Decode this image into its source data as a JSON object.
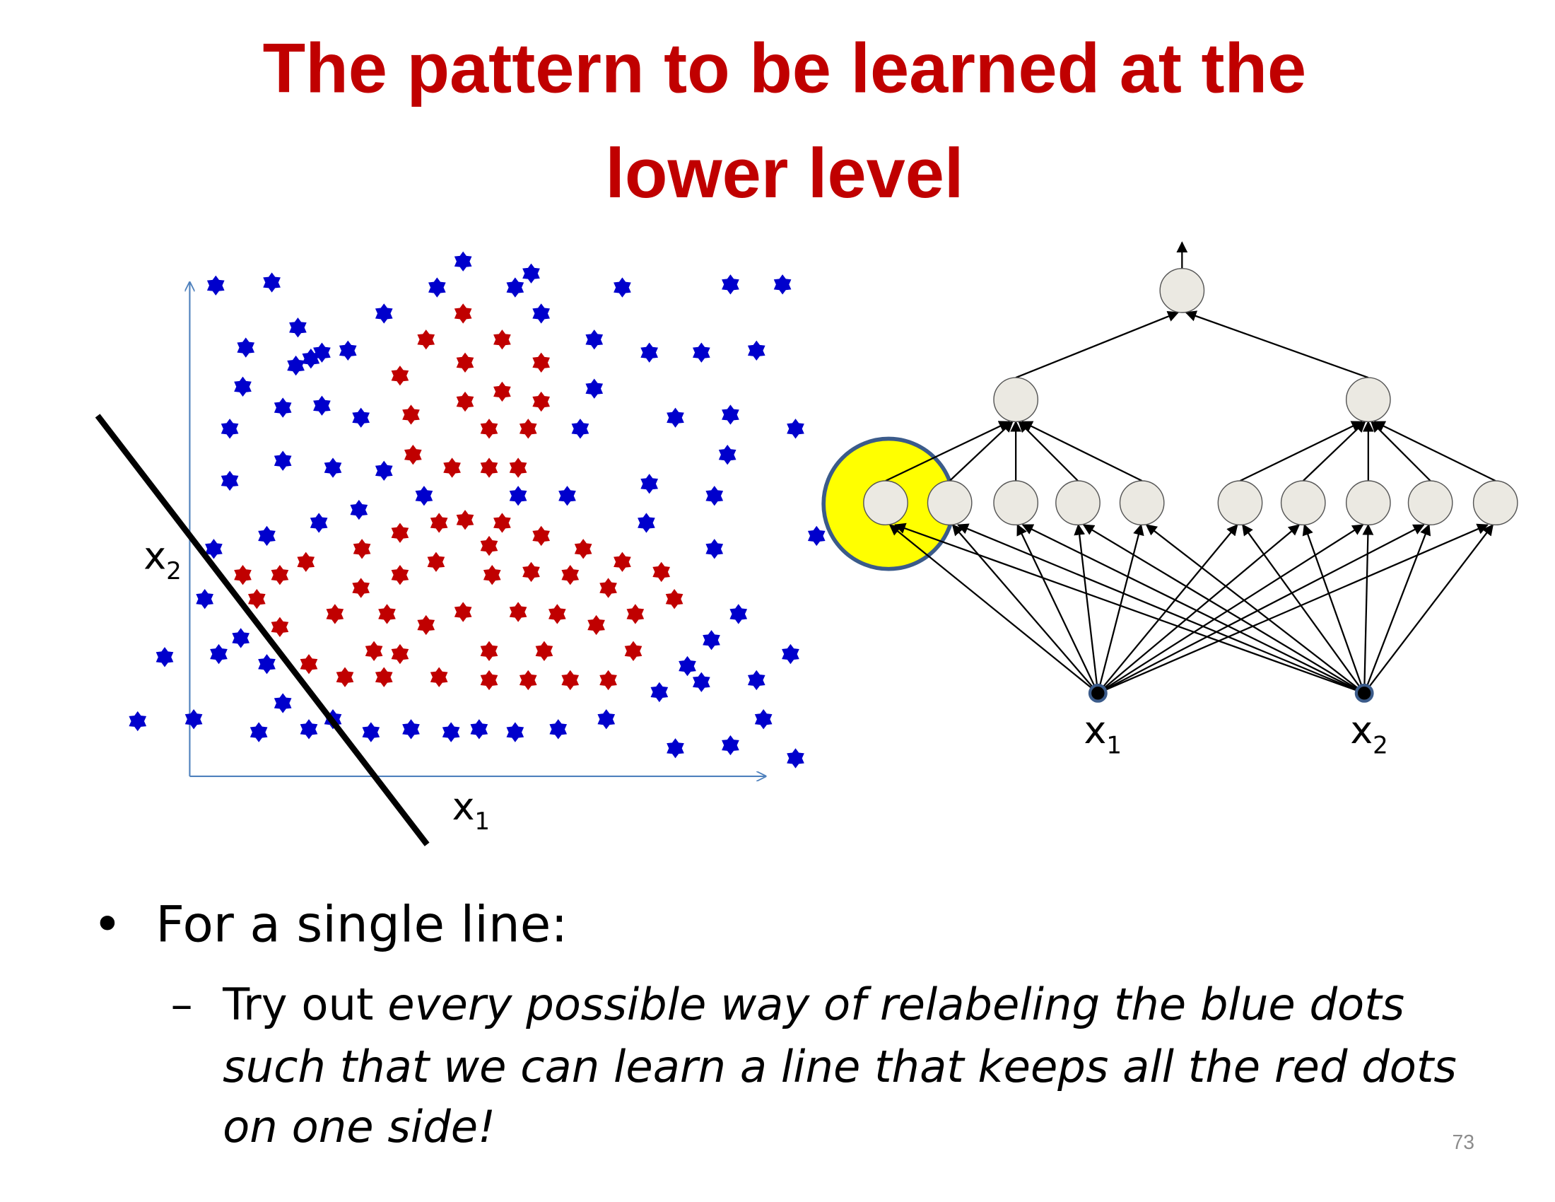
{
  "slide": {
    "title_line1": "The pattern to be learned at the",
    "title_line2": "lower level",
    "page_number": "73"
  },
  "scatter": {
    "x_axis_label": "x",
    "x_axis_sub": "1",
    "y_axis_label": "x",
    "y_axis_sub": "2"
  },
  "network": {
    "input1_label": "x",
    "input1_sub": "1",
    "input2_label": "x",
    "input2_sub": "2"
  },
  "bullets": {
    "main_bullet": "•",
    "main_text": "For a single line:",
    "sub_dash": "–",
    "sub_text_plain": "Try out ",
    "sub_text_italic_1": "every possible way of relabeling the blue dots",
    "sub_text_italic_2": "such that we can learn a line that keeps all the red dots",
    "sub_text_italic_3": "on one side!"
  },
  "colors": {
    "title": "#c00000",
    "blue_dot": "#0000cc",
    "red_dot": "#c00000",
    "axis": "#4f81bd",
    "highlight": "#ffff00",
    "highlight_border": "#3b5b8a",
    "node_fill": "#ebe9e2"
  }
}
